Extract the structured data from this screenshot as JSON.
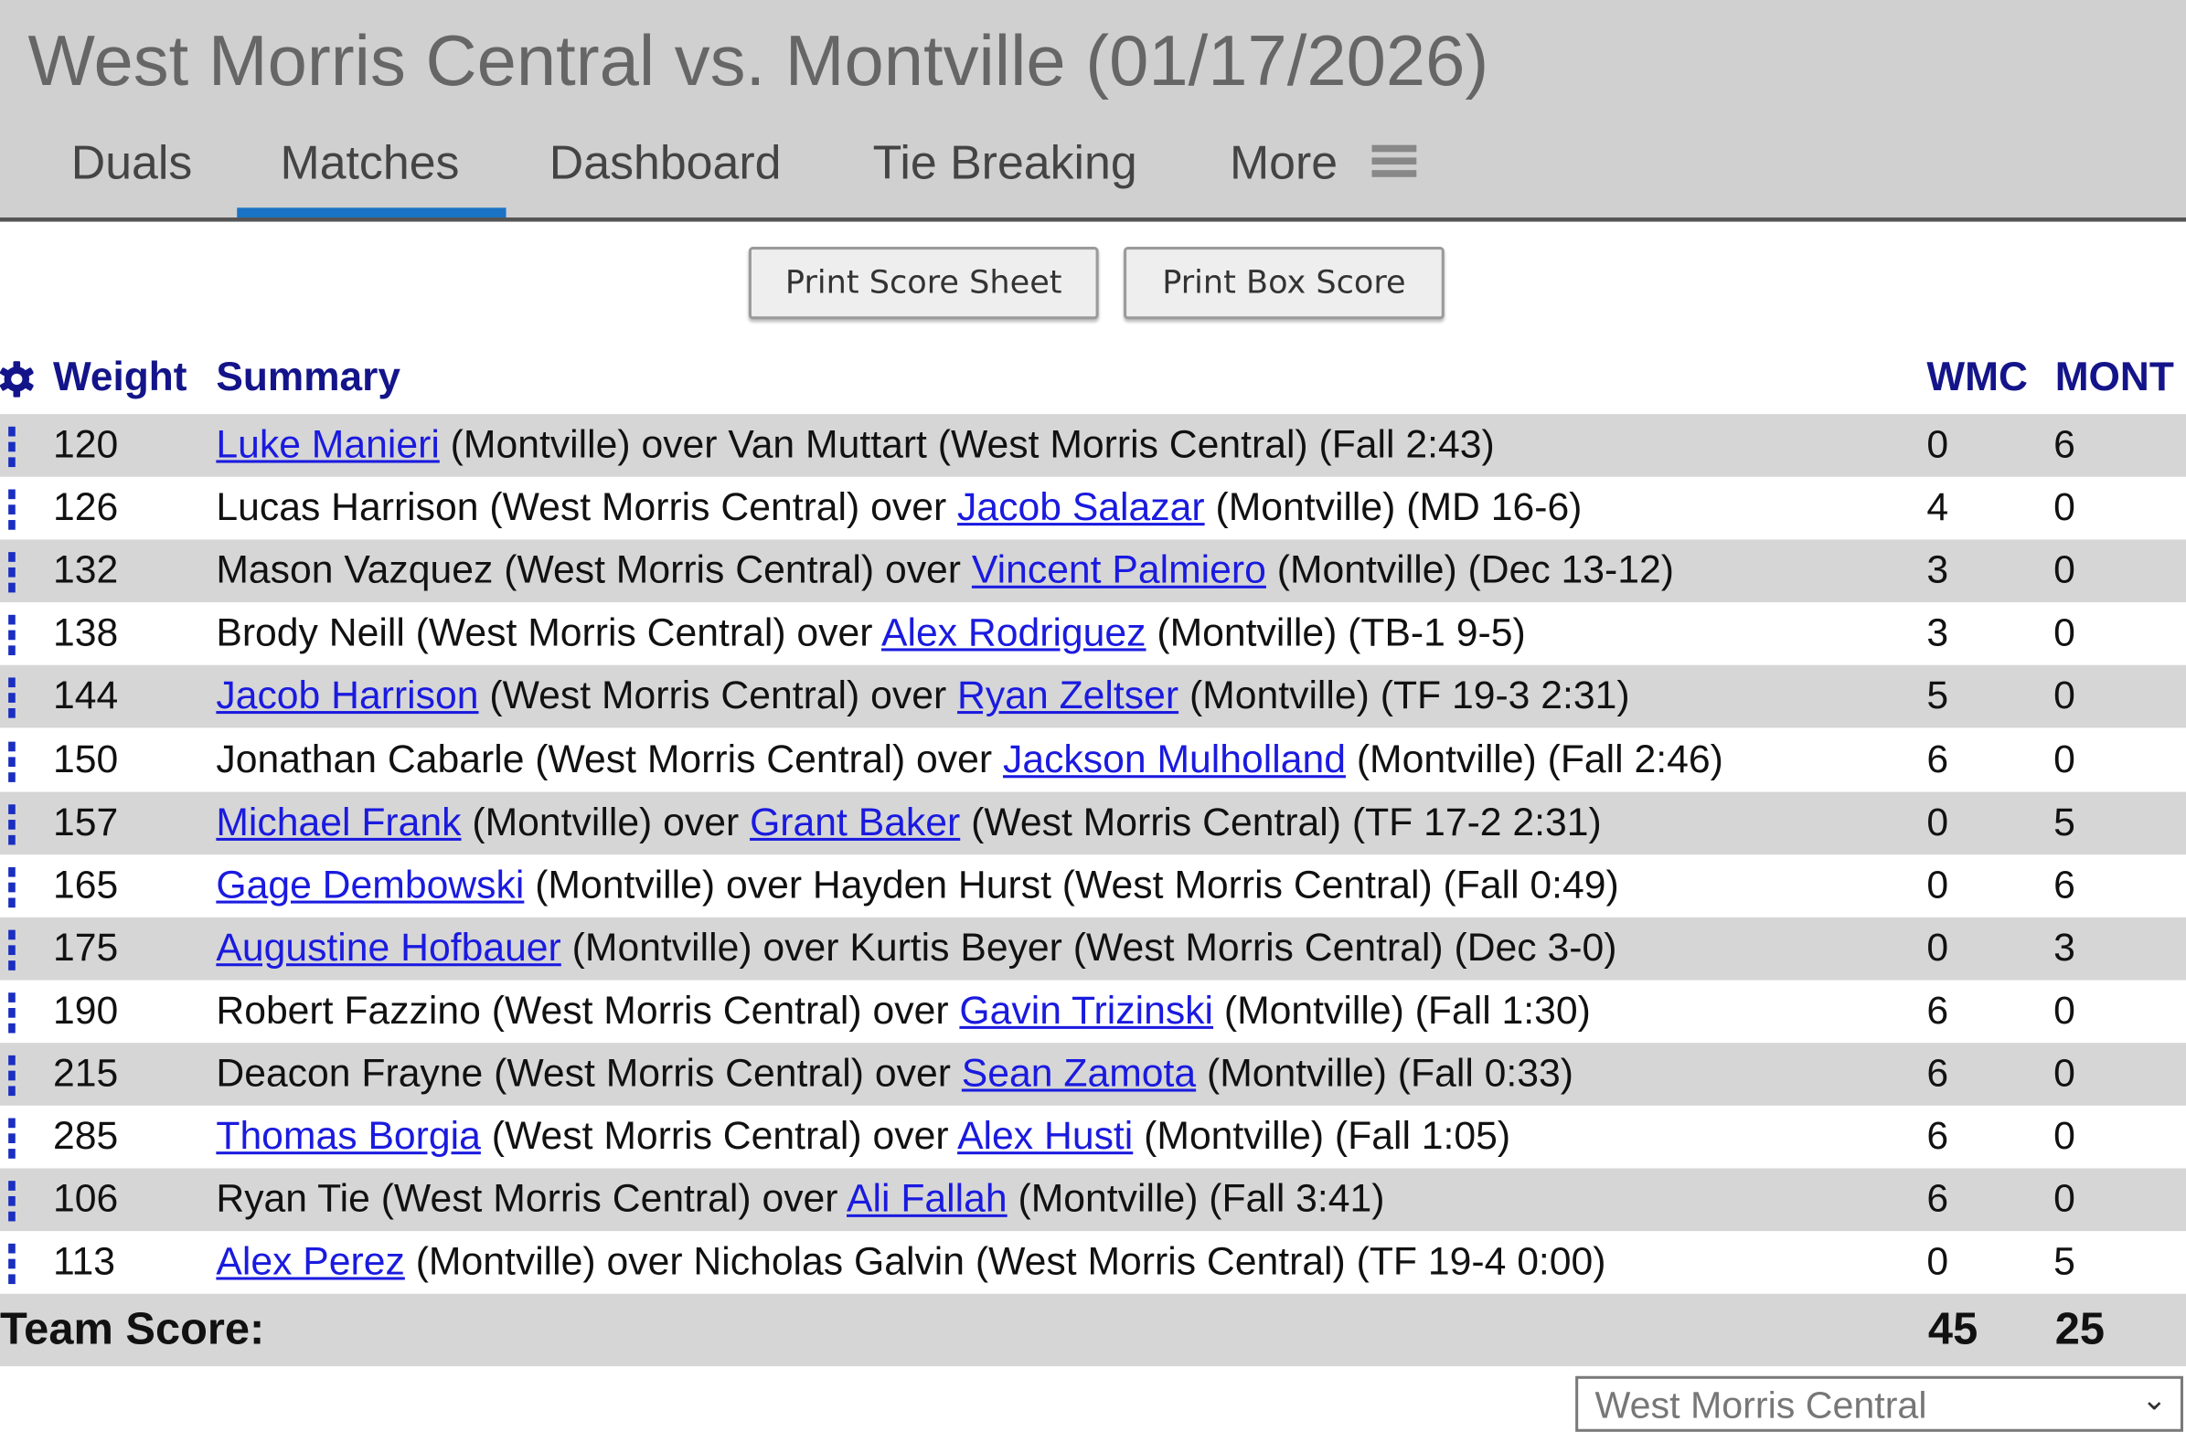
{
  "header": {
    "title": "West Morris Central vs. Montville (01/17/2026)",
    "tabs": [
      {
        "label": "Duals",
        "active": false
      },
      {
        "label": "Matches",
        "active": true
      },
      {
        "label": "Dashboard",
        "active": false
      },
      {
        "label": "Tie Breaking",
        "active": false
      },
      {
        "label": "More",
        "active": false
      }
    ],
    "more_icon": "hamburger-icon",
    "accent_color": "#1a73c4"
  },
  "buttons": {
    "print_score_sheet": "Print Score Sheet",
    "print_box_score": "Print Box Score"
  },
  "table": {
    "settings_icon": "gear-icon",
    "columns": {
      "weight": "Weight",
      "summary": "Summary",
      "team1": "WMC",
      "team2": "MONT"
    },
    "rows": [
      {
        "weight": "120",
        "summary": [
          {
            "text": "Luke Manieri",
            "link": true
          },
          {
            "text": " (Montville) over Van Muttart (West Morris Central) (Fall 2:43)",
            "link": false
          }
        ],
        "team1": "0",
        "team2": "6"
      },
      {
        "weight": "126",
        "summary": [
          {
            "text": "Lucas Harrison (West Morris Central) over ",
            "link": false
          },
          {
            "text": "Jacob Salazar",
            "link": true
          },
          {
            "text": " (Montville) (MD 16-6)",
            "link": false
          }
        ],
        "team1": "4",
        "team2": "0"
      },
      {
        "weight": "132",
        "summary": [
          {
            "text": "Mason Vazquez (West Morris Central) over ",
            "link": false
          },
          {
            "text": "Vincent Palmiero",
            "link": true
          },
          {
            "text": " (Montville) (Dec 13-12)",
            "link": false
          }
        ],
        "team1": "3",
        "team2": "0"
      },
      {
        "weight": "138",
        "summary": [
          {
            "text": "Brody Neill (West Morris Central) over ",
            "link": false
          },
          {
            "text": "Alex Rodriguez",
            "link": true
          },
          {
            "text": " (Montville) (TB-1 9-5)",
            "link": false
          }
        ],
        "team1": "3",
        "team2": "0"
      },
      {
        "weight": "144",
        "summary": [
          {
            "text": "Jacob Harrison",
            "link": true
          },
          {
            "text": " (West Morris Central) over ",
            "link": false
          },
          {
            "text": "Ryan Zeltser",
            "link": true
          },
          {
            "text": " (Montville) (TF 19-3 2:31)",
            "link": false
          }
        ],
        "team1": "5",
        "team2": "0"
      },
      {
        "weight": "150",
        "summary": [
          {
            "text": "Jonathan Cabarle (West Morris Central) over ",
            "link": false
          },
          {
            "text": "Jackson Mulholland",
            "link": true
          },
          {
            "text": " (Montville) (Fall 2:46)",
            "link": false
          }
        ],
        "team1": "6",
        "team2": "0"
      },
      {
        "weight": "157",
        "summary": [
          {
            "text": "Michael Frank",
            "link": true
          },
          {
            "text": " (Montville) over ",
            "link": false
          },
          {
            "text": "Grant Baker",
            "link": true
          },
          {
            "text": " (West Morris Central) (TF 17-2 2:31)",
            "link": false
          }
        ],
        "team1": "0",
        "team2": "5"
      },
      {
        "weight": "165",
        "summary": [
          {
            "text": "Gage Dembowski",
            "link": true
          },
          {
            "text": " (Montville) over Hayden Hurst (West Morris Central) (Fall 0:49)",
            "link": false
          }
        ],
        "team1": "0",
        "team2": "6"
      },
      {
        "weight": "175",
        "summary": [
          {
            "text": "Augustine Hofbauer",
            "link": true
          },
          {
            "text": " (Montville) over Kurtis Beyer (West Morris Central) (Dec 3-0)",
            "link": false
          }
        ],
        "team1": "0",
        "team2": "3"
      },
      {
        "weight": "190",
        "summary": [
          {
            "text": "Robert Fazzino (West Morris Central) over ",
            "link": false
          },
          {
            "text": "Gavin Trizinski",
            "link": true
          },
          {
            "text": " (Montville) (Fall 1:30)",
            "link": false
          }
        ],
        "team1": "6",
        "team2": "0"
      },
      {
        "weight": "215",
        "summary": [
          {
            "text": "Deacon Frayne (West Morris Central) over ",
            "link": false
          },
          {
            "text": "Sean Zamota",
            "link": true
          },
          {
            "text": " (Montville) (Fall 0:33)",
            "link": false
          }
        ],
        "team1": "6",
        "team2": "0"
      },
      {
        "weight": "285",
        "summary": [
          {
            "text": "Thomas Borgia",
            "link": true
          },
          {
            "text": " (West Morris Central) over ",
            "link": false
          },
          {
            "text": "Alex Husti",
            "link": true
          },
          {
            "text": " (Montville) (Fall 1:05)",
            "link": false
          }
        ],
        "team1": "6",
        "team2": "0"
      },
      {
        "weight": "106",
        "summary": [
          {
            "text": "Ryan Tie (West Morris Central) over ",
            "link": false
          },
          {
            "text": "Ali Fallah",
            "link": true
          },
          {
            "text": " (Montville) (Fall 3:41)",
            "link": false
          }
        ],
        "team1": "6",
        "team2": "0"
      },
      {
        "weight": "113",
        "summary": [
          {
            "text": "Alex Perez",
            "link": true
          },
          {
            "text": " (Montville) over Nicholas Galvin (West Morris Central) (TF 19-4 0:00)",
            "link": false
          }
        ],
        "team1": "0",
        "team2": "5"
      }
    ],
    "row_menu_icon": "vertical-dots-icon",
    "team_score": {
      "label": "Team Score:",
      "team1": "45",
      "team2": "25"
    }
  },
  "team_select": {
    "value": "West Morris Central"
  },
  "colors": {
    "header_bg": "#d0d0d0",
    "column_header_text": "#14148a",
    "link": "#1a1adf",
    "row_shade": "#d6d6d6"
  }
}
